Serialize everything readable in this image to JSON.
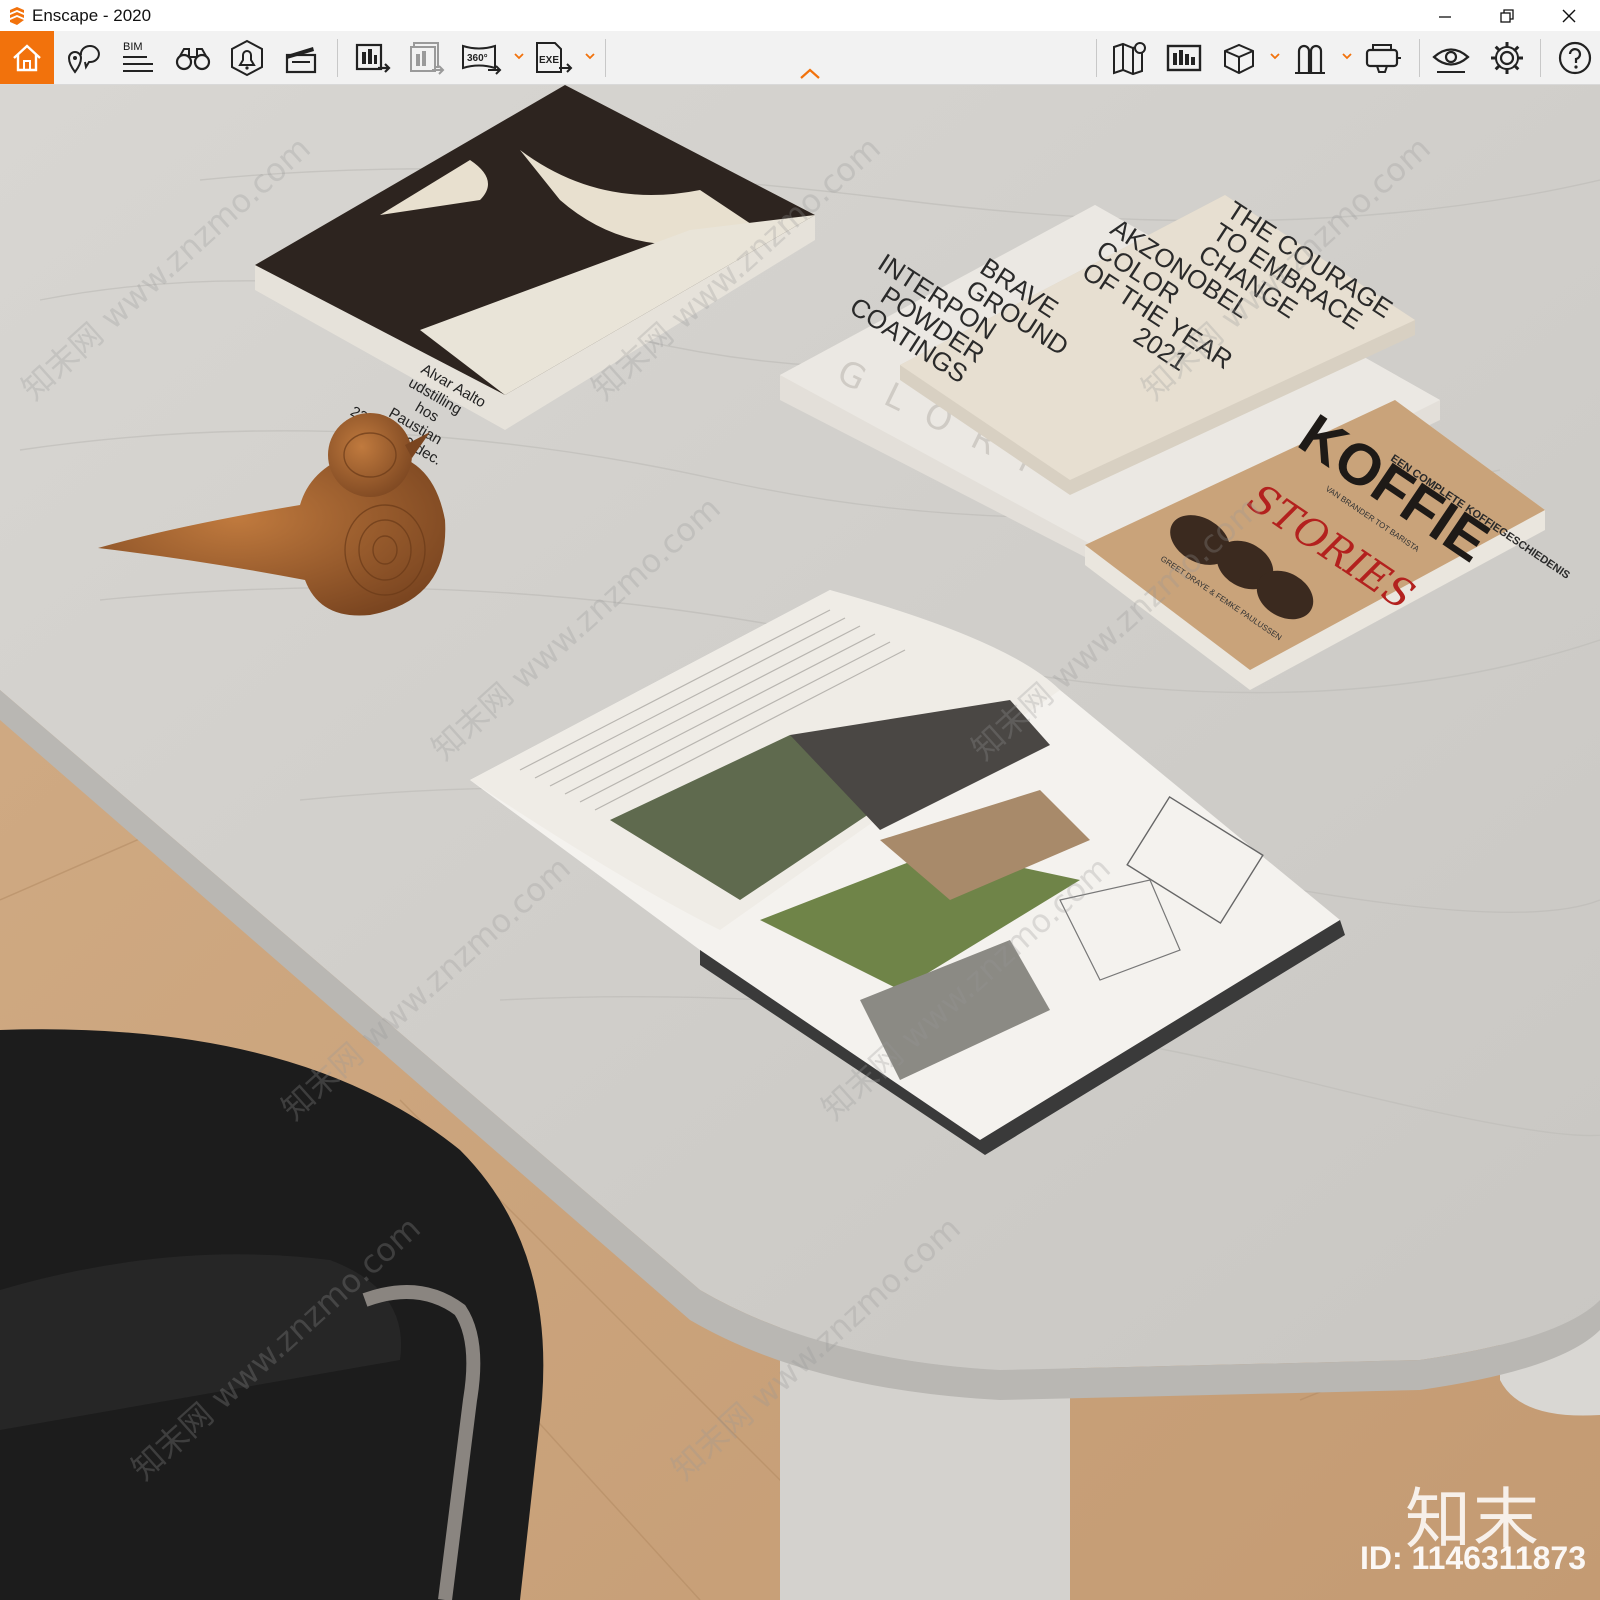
{
  "window": {
    "title": "Enscape - 2020",
    "controls": [
      "minimize-icon",
      "restore-icon",
      "close-icon"
    ]
  },
  "toolbar": {
    "accent_color": "#f2720c",
    "bim_label": "BIM",
    "panorama_label": "360°",
    "exe_label": "EXE",
    "left_tools": [
      "home-icon",
      "location-pin-icon",
      "bim-icon",
      "binoculars-icon",
      "bell-icon",
      "clapperboard-icon"
    ],
    "export_tools": [
      "screenshot-export-icon",
      "batch-export-icon",
      "panorama-360-icon",
      "exe-export-icon"
    ],
    "right_tools": [
      "map-icon",
      "asset-library-icon",
      "cube-icon",
      "asset-icon",
      "vr-headset-icon",
      "view-settings-icon",
      "settings-gear-icon",
      "help-icon"
    ]
  },
  "scene": {
    "book1": {
      "lines": [
        "Alvar Aalto",
        "udstilling",
        "hos",
        "Paustian",
        "23.nov.-29.dec."
      ]
    },
    "book2": {
      "spine_text": "GLORY"
    },
    "book3": {
      "lines": [
        "THE COURAGE",
        "TO EMBRACE",
        "CHANGE",
        "AKZONOBEL",
        "COLOR",
        "OF THE YEAR",
        "2021",
        "BRAVE",
        "GROUND",
        "INTERPON",
        "POWDER",
        "COATINGS"
      ]
    },
    "book4": {
      "top": "EEN COMPLETE KOFFIEGESCHIEDENIS",
      "title": "KOFFIE",
      "subtitle": "VAN BRANDER TOT BARISTA",
      "script": "STORIES",
      "authors": "GREET DRAYE & FEMKE PAULUSSEN"
    }
  },
  "watermark": {
    "logo": "知末",
    "id": "ID: 1146311873",
    "text": "知末网 www.znzmo.com"
  }
}
